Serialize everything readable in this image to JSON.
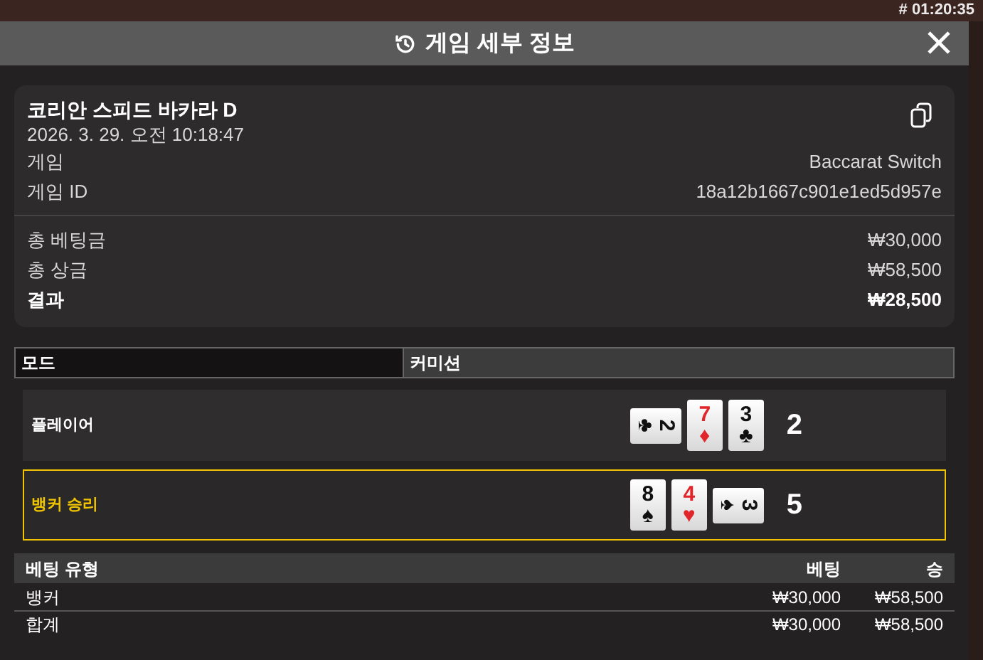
{
  "timer": "# 01:20:35",
  "header": {
    "title": "게임 세부 정보"
  },
  "summary": {
    "table_name": "코리안 스피드 바카라 D",
    "datetime": "2026. 3. 29. 오전 10:18:47",
    "info": [
      {
        "label": "게임",
        "value": "Baccarat Switch"
      },
      {
        "label": "게임 ID",
        "value": "18a12b1667c901e1ed5d957e"
      }
    ],
    "totals": [
      {
        "label": "총 베팅금",
        "value": "₩30,000",
        "bold": false
      },
      {
        "label": "총 상금",
        "value": "₩58,500",
        "bold": false
      },
      {
        "label": "결과",
        "value": "₩28,500",
        "bold": true
      }
    ]
  },
  "mode_table": {
    "columns": [
      "모드",
      "커미션"
    ]
  },
  "hands": [
    {
      "label": "플레이어",
      "selected": false,
      "score": "2",
      "cards": [
        {
          "rank": "2",
          "suit": "♣",
          "color": "#111111",
          "rotated": true
        },
        {
          "rank": "7",
          "suit": "♦",
          "color": "#e0262b",
          "rotated": false
        },
        {
          "rank": "3",
          "suit": "♣",
          "color": "#111111",
          "rotated": false
        }
      ]
    },
    {
      "label": "뱅커 승리",
      "selected": true,
      "score": "5",
      "cards": [
        {
          "rank": "8",
          "suit": "♠",
          "color": "#111111",
          "rotated": false
        },
        {
          "rank": "4",
          "suit": "♥",
          "color": "#e0262b",
          "rotated": false
        },
        {
          "rank": "3",
          "suit": "♠",
          "color": "#111111",
          "rotated": true
        }
      ]
    }
  ],
  "bets_table": {
    "columns": [
      "베팅 유형",
      "베팅",
      "승"
    ],
    "rows": [
      [
        "뱅커",
        "₩30,000",
        "₩58,500"
      ],
      [
        "합계",
        "₩30,000",
        "₩58,500"
      ]
    ]
  }
}
